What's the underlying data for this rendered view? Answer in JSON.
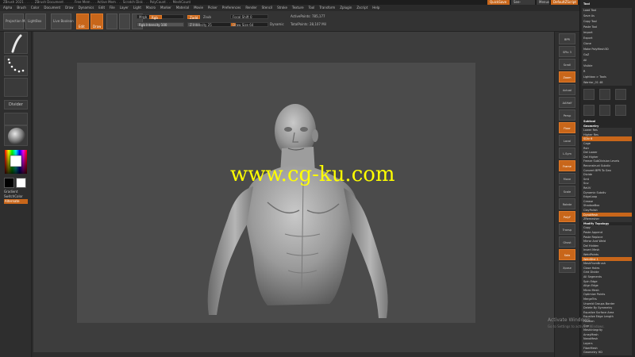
{
  "app": {
    "title_bar_text": "ZBrush 2021 . . . . . ZBrush Document . . . . . Free Mem . . . Active Mem . . . Scratch Disk . . . PolyCount . . . MeshCount",
    "quicksave": "QuickSave",
    "see_through": "See-through 0",
    "menus": "Menus",
    "default_zscript": "DefaultZScript"
  },
  "menubar": {
    "items": [
      "Alpha",
      "Brush",
      "Color",
      "Document",
      "Draw",
      "Dynamics",
      "Edit",
      "File",
      "Layer",
      "Light",
      "Macro",
      "Marker",
      "Material",
      "Movie",
      "Picker",
      "Preferences",
      "Render",
      "Stencil",
      "Stroke",
      "Texture",
      "Tool",
      "Transform",
      "Zplugin",
      "Zscript",
      "Help"
    ]
  },
  "toolbar": {
    "projection_master": "Projection Master",
    "lightbox": "LightBox",
    "live_boolean": "Live Boolean",
    "edit_label": "Edit",
    "draw_label": "Draw",
    "focal_shift": "Focal Shift 0",
    "draw_size": "Draw Size 64",
    "z_intensity": "Z Intensity 25",
    "rgb_intensity": "Rgb Intensity 100",
    "rgb": "Rgb",
    "zadd": "Zadd",
    "zsub": "Zsub",
    "mrgb": "Mrgb",
    "active_points": "ActivePoints: 785,177",
    "total_points": "TotalPoints: 28,107 Mil",
    "dynamic": "Dynamic"
  },
  "leftshelf": {
    "divider": "Divider",
    "gradient": "Gradient",
    "switch_color": "SwitchColor",
    "alternate": "Alternate",
    "colors": {
      "primary": "#000000",
      "secondary": "#ffffff",
      "accent": "#c8661a"
    }
  },
  "rightshelf": {
    "buttons": [
      "BPR",
      "SPix 3",
      "Scroll",
      "Zoom",
      "Actual",
      "AAHalf",
      "Persp",
      "Floor",
      "Local",
      "L.Sym",
      "Frame",
      "Move",
      "Scale",
      "Rotate",
      "PolyF",
      "Transp",
      "Ghost",
      "Solo",
      "Xpose"
    ]
  },
  "tray": {
    "header": "Tool",
    "rows": [
      "Load Tool",
      "Save As",
      "Copy Tool",
      "Paste Tool",
      "Import",
      "Export",
      "Clone",
      "Make PolyMesh3D",
      "GoZ",
      "All",
      "Visible",
      "R",
      "Lightbox > Tools",
      "Warrior_01 48"
    ],
    "subtool_section": {
      "title": "Subtool",
      "geometry": "Geometry",
      "lower_res": "Lower Res",
      "higher_res": "Higher Res",
      "sdiv": "SDiv 6",
      "cage": "Cage",
      "rstr": "Rstr",
      "del_lower": "Del Lower",
      "del_higher": "Del Higher",
      "freeze": "Freeze SubDivision Levels",
      "reconstruct": "Reconstruct Subdiv",
      "convert_bpr": "Convert BPR To Geo",
      "divide": "Divide",
      "smt": "Smt",
      "suv": "Suv",
      "reuv": "ReUV",
      "dynamic_subdiv": "Dynamic Subdiv",
      "edgeloop": "EdgeLoop",
      "crease": "Crease",
      "shadowbox": "ShadowBox",
      "claypolish": "ClayPolish",
      "dynamesh": "DynaMesh",
      "zremesher": "ZRemesher",
      "modify_topology": "Modify Topology",
      "copy": "Copy",
      "paste_append": "Paste Append",
      "paste_replace": "Paste Replace",
      "mirror_and_weld": "Mirror And Weld",
      "del_hidden": "Del Hidden",
      "insert_mesh": "Insert Mesh",
      "weld_points": "WeldPoints",
      "weld_dist": "WeldDist 1",
      "mesh_from_brush": "MeshFromBrush",
      "close_holes": "Close Holes",
      "grid_divide": "Grid Divide",
      "all_segments": "All Segments",
      "spin_edge": "Spin Edge",
      "align_edge": "Align Edge",
      "micro_mesh": "Micro Mesh",
      "optimize_points": "Optimize Points",
      "merge_tris": "MergeTris",
      "unweld_groups_border": "Unweld Groups Border",
      "delete_by_symmetry": "Delete By Symmetry",
      "equalize_surface_area": "Equalize Surface Area",
      "equalize_edge_length": "Equalize Edge Length",
      "position": "Position",
      "size": "Size",
      "mesh_integrity": "MeshIntegrity",
      "arraymesh": "ArrayMesh",
      "nanomesh": "NanoMesh",
      "layers": "Layers",
      "fibermesh": "FiberMesh",
      "geometry_hd": "Geometry HD"
    }
  },
  "canvas": {
    "watermark": "www.cg-ku.com",
    "activate_windows": "Activate Windows",
    "activate_hint": "Go to Settings to activate Windows."
  }
}
